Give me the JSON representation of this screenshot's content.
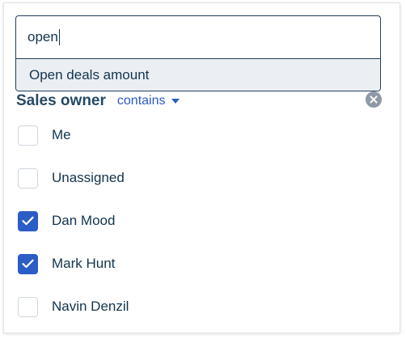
{
  "search": {
    "value": "open",
    "suggestions": [
      {
        "label": "Open deals amount"
      }
    ]
  },
  "filter": {
    "title": "Sales owner",
    "operator": "contains",
    "clear_icon": "clear-x-icon"
  },
  "options": [
    {
      "label": "Me",
      "checked": false
    },
    {
      "label": "Unassigned",
      "checked": false
    },
    {
      "label": "Dan Mood",
      "checked": true
    },
    {
      "label": "Mark Hunt",
      "checked": true
    },
    {
      "label": "Navin Denzil",
      "checked": false
    }
  ],
  "colors": {
    "accent": "#2c5cc5",
    "text": "#12344d",
    "title": "#264966",
    "suggestion_bg": "#ebeff3"
  }
}
